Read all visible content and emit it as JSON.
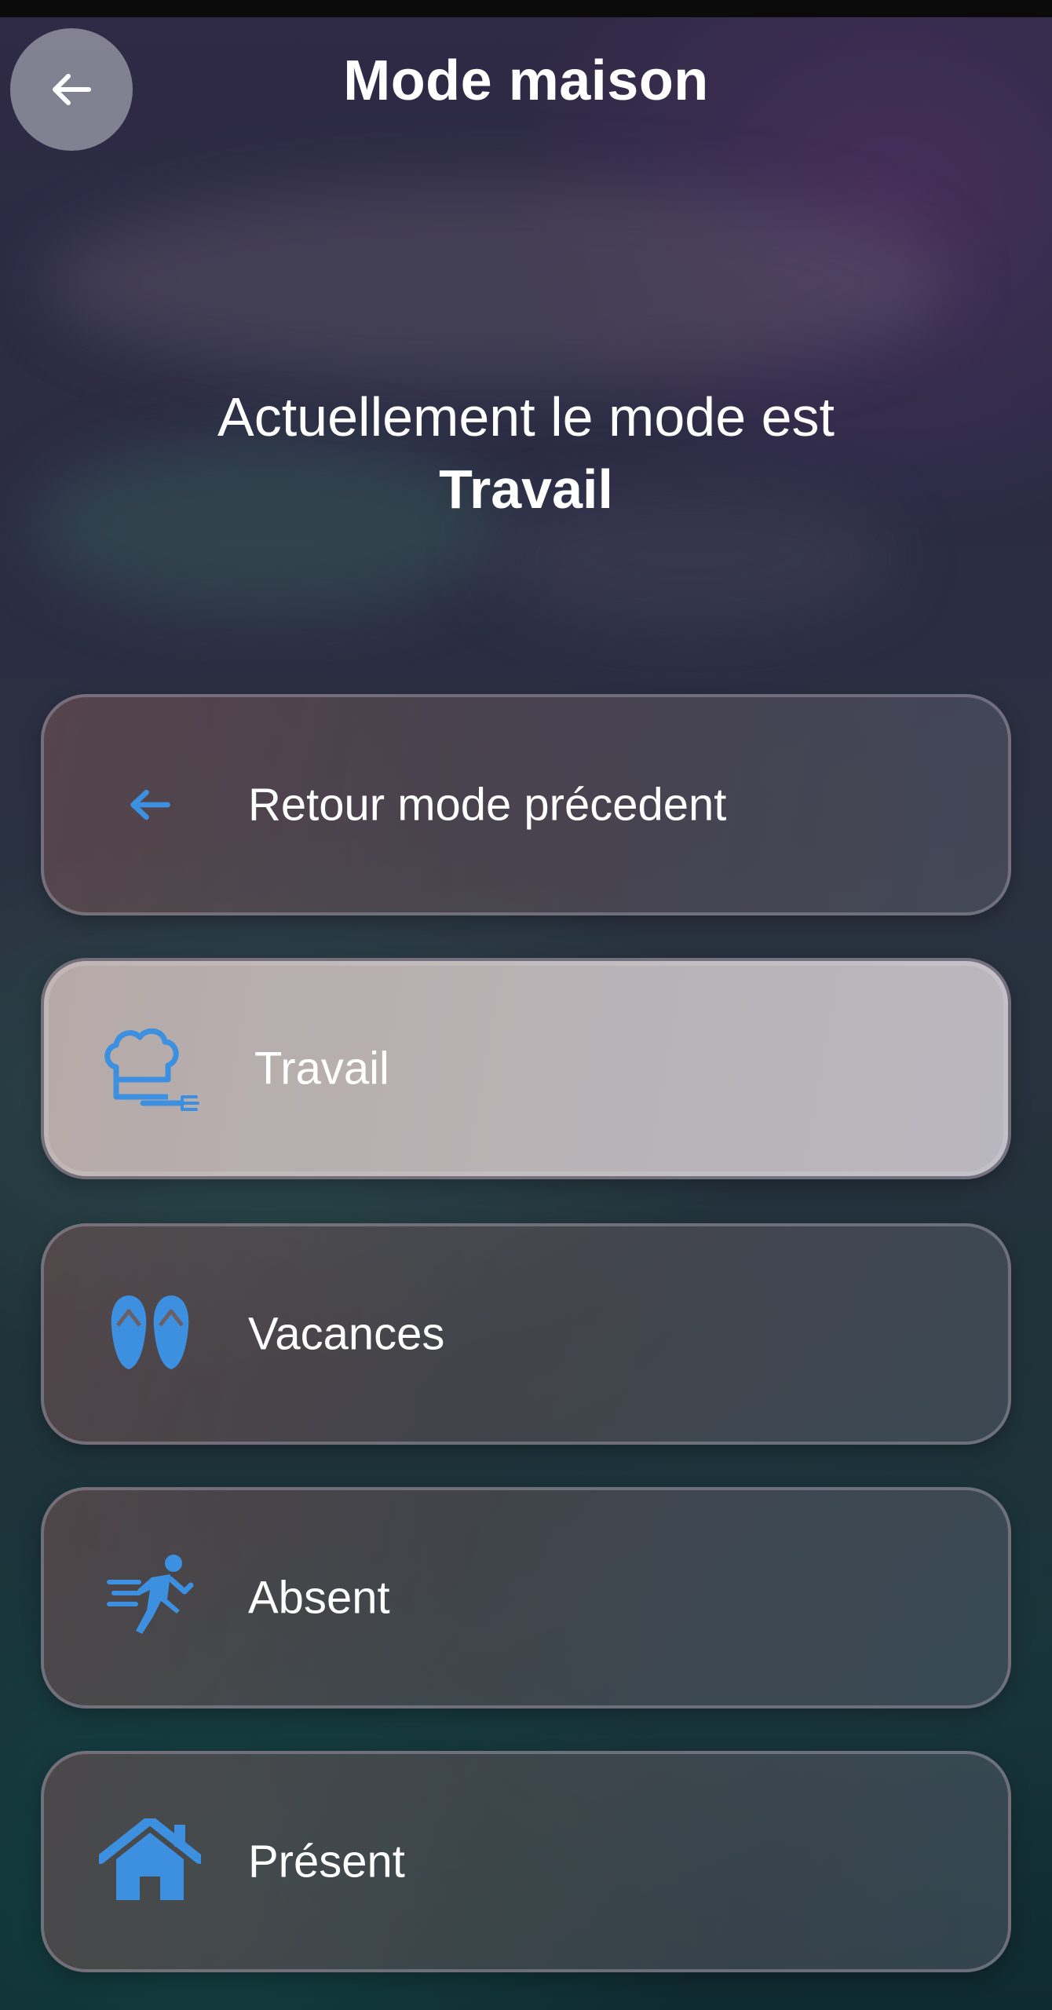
{
  "header": {
    "title": "Mode maison",
    "back_icon": "arrow-left-icon"
  },
  "status": {
    "line1": "Actuellement le mode est",
    "mode": "Travail"
  },
  "modes": [
    {
      "label": "Retour mode précedent",
      "icon": "arrow-left-icon",
      "active": false
    },
    {
      "label": "Travail",
      "icon": "chef-hat-fork-icon",
      "active": true
    },
    {
      "label": "Vacances",
      "icon": "flip-flops-icon",
      "active": false
    },
    {
      "label": "Absent",
      "icon": "running-person-icon",
      "active": false
    },
    {
      "label": "Présent",
      "icon": "house-icon",
      "active": false
    }
  ],
  "colors": {
    "icon_accent": "#3d8fe0",
    "text": "#ffffff",
    "active_card": "#b8b2b4"
  }
}
